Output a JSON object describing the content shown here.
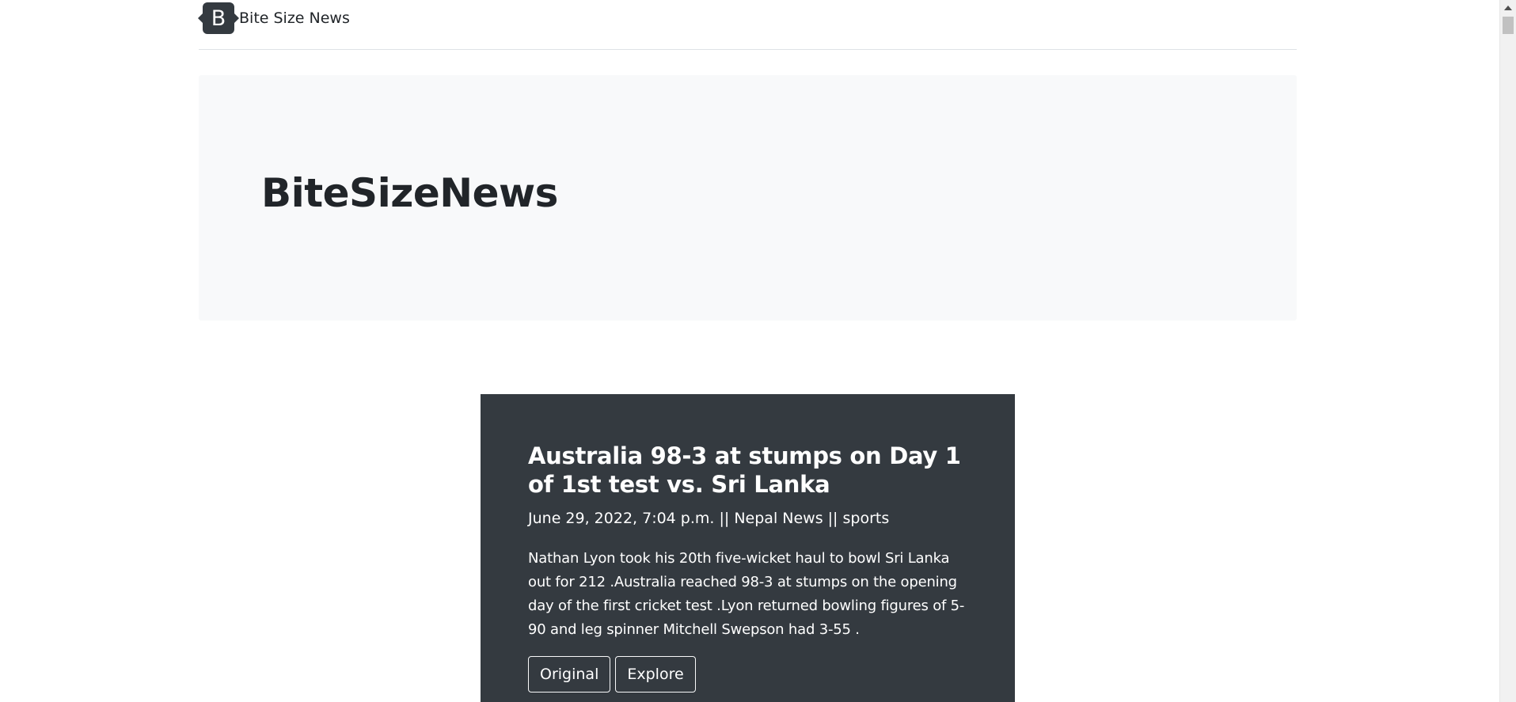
{
  "header": {
    "logo_letter": "B",
    "brand_name": "Bite Size News"
  },
  "hero": {
    "title": "BiteSizeNews"
  },
  "article": {
    "title": "Australia 98-3 at stumps on Day 1 of 1st test vs. Sri Lanka",
    "meta": "June 29, 2022, 7:04 p.m. || Nepal News || sports",
    "summary": "Nathan Lyon took his 20th five-wicket haul to bowl Sri Lanka out for 212 .Australia reached 98-3 at stumps on the opening day of the first cricket test .Lyon returned bowling figures of 5-90 and leg spinner Mitchell Swepson had 3-55 .",
    "buttons": {
      "original": "Original",
      "explore": "Explore"
    }
  },
  "colors": {
    "card_bg": "#343a40",
    "hero_bg": "#f8f9fa",
    "text": "#212529"
  }
}
